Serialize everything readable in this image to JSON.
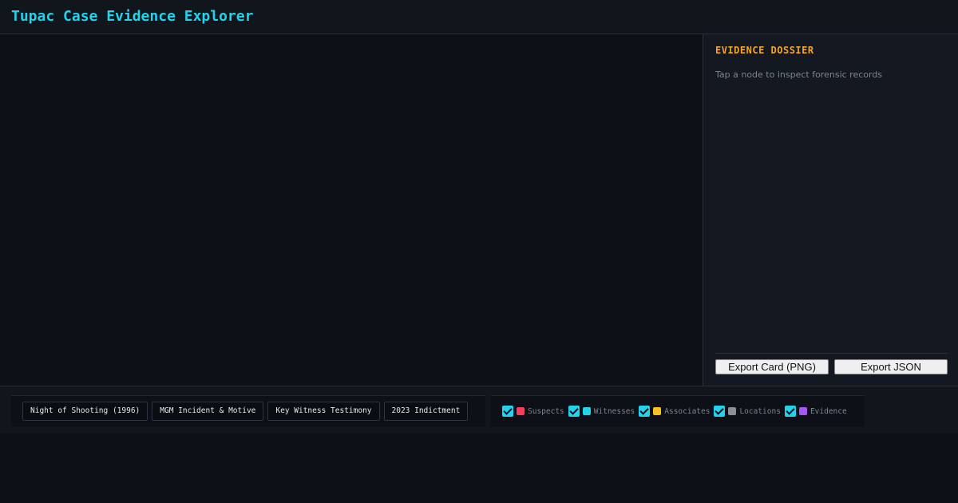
{
  "header": {
    "title": "Tupac Case Evidence Explorer"
  },
  "dossier": {
    "title": "EVIDENCE DOSSIER",
    "hint": "Tap a node to inspect forensic records",
    "export_png_label": "Export Card (PNG)",
    "export_json_label": "Export JSON"
  },
  "chapters": [
    {
      "label": "Night of Shooting (1996)"
    },
    {
      "label": "MGM Incident & Motive"
    },
    {
      "label": "Key Witness Testimony"
    },
    {
      "label": "2023 Indictment"
    }
  ],
  "filters": [
    {
      "label": "Suspects",
      "color": "#f43f5e",
      "checked": true
    },
    {
      "label": "Witnesses",
      "color": "#22d3ee",
      "checked": true
    },
    {
      "label": "Associates",
      "color": "#fbbf24",
      "checked": true
    },
    {
      "label": "Locations",
      "color": "#8a8f98",
      "checked": true
    },
    {
      "label": "Evidence",
      "color": "#a855f7",
      "checked": true
    }
  ],
  "colors": {
    "accent": "#22d3ee",
    "dossier_title": "#f5a524"
  }
}
